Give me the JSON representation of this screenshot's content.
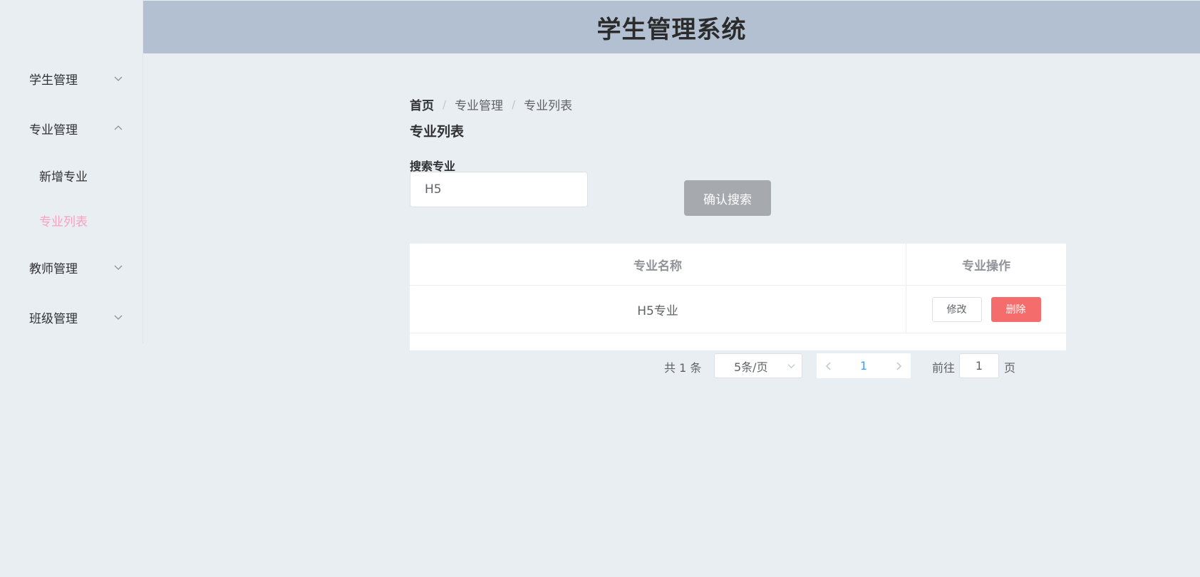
{
  "header": {
    "title": "学生管理系统"
  },
  "sidebar": {
    "items": [
      {
        "label": "学生管理"
      },
      {
        "label": "专业管理"
      },
      {
        "label": "新增专业"
      },
      {
        "label": "专业列表"
      },
      {
        "label": "教师管理"
      },
      {
        "label": "班级管理"
      }
    ]
  },
  "breadcrumb": {
    "home": "首页",
    "level1": "专业管理",
    "level2": "专业列表",
    "separator": "/"
  },
  "page": {
    "title": "专业列表"
  },
  "search": {
    "label": "搜索专业",
    "value": "H5",
    "button_label": "确认搜索"
  },
  "table": {
    "headers": [
      "专业名称",
      "专业操作"
    ],
    "rows": [
      {
        "name": "H5专业",
        "edit_label": "修改",
        "delete_label": "删除"
      }
    ]
  },
  "pagination": {
    "total_text": "共 1 条",
    "page_size": "5条/页",
    "current_page": "1",
    "goto_label": "前往",
    "goto_value": "1",
    "goto_suffix": "页"
  },
  "colors": {
    "header_bg": "#b3c0d1",
    "active_menu": "#f5a3bf",
    "danger": "#f56c6c",
    "primary": "#409eff"
  }
}
